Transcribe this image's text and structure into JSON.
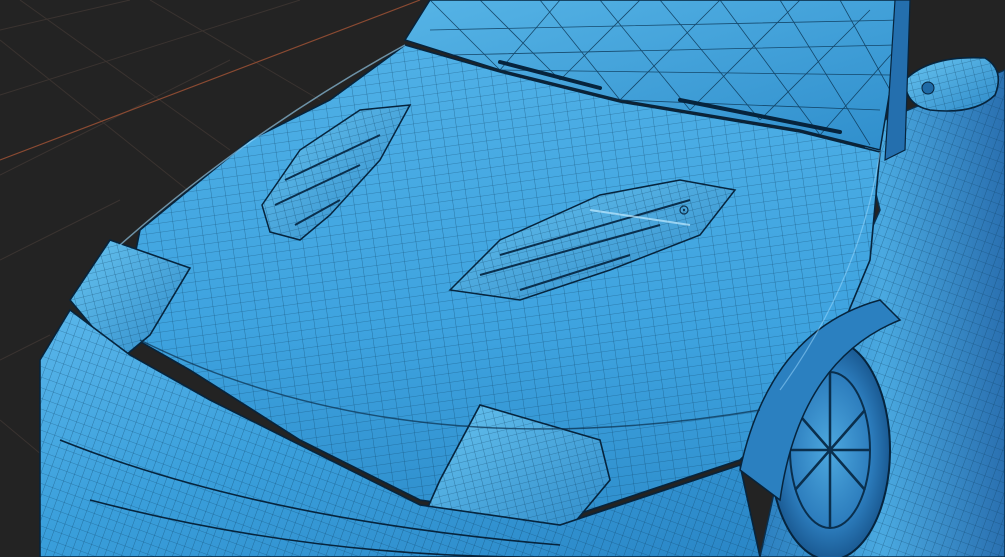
{
  "viewport": {
    "background": "#232323",
    "grid_color": "#3a3330",
    "axis_color": "#8a4a32",
    "shading": "wireframe-overlay",
    "mesh_base_color": "#3a9fdb",
    "mesh_highlight_color": "#7fd0f5",
    "mesh_wire_color": "#0b3b5c"
  },
  "scene": {
    "object": "car-front-hood-mesh",
    "features": [
      "windshield",
      "wipers",
      "side-mirror",
      "hood-vent-left",
      "hood-vent-right",
      "headlight-left",
      "headlight-right",
      "front-bumper",
      "front-wheel",
      "fender"
    ]
  },
  "cursor": {
    "icon": "crosshair-cursor-icon"
  }
}
